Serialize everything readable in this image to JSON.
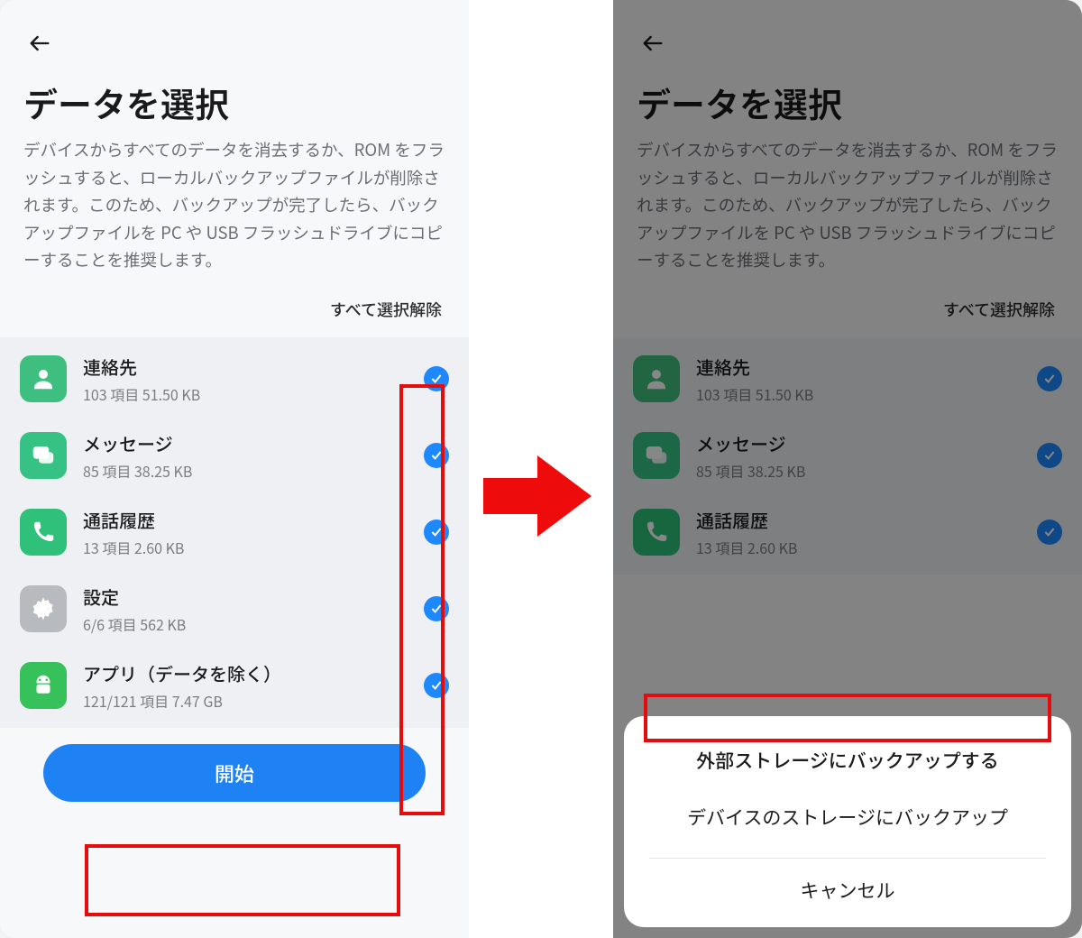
{
  "left": {
    "title": "データを選択",
    "description": "デバイスからすべてのデータを消去するか、ROM をフラッシュすると、ローカルバックアップファイルが削除されます。このため、バックアップが完了したら、バックアップファイルを PC や USB フラッシュドライブにコピーすることを推奨します。",
    "deselect_all": "すべて選択解除",
    "items": [
      {
        "icon": "contact",
        "title": "連絡先",
        "sub": "103 項目  51.50 KB"
      },
      {
        "icon": "message",
        "title": "メッセージ",
        "sub": "85 項目  38.25 KB"
      },
      {
        "icon": "call",
        "title": "通話履歴",
        "sub": "13 項目  2.60 KB"
      },
      {
        "icon": "settings",
        "title": "設定",
        "sub": "6/6 項目  562 KB"
      },
      {
        "icon": "apps",
        "title": "アプリ（データを除く）",
        "sub": "121/121 項目  7.47 GB"
      }
    ],
    "primary": "開始"
  },
  "right": {
    "title": "データを選択",
    "description": "デバイスからすべてのデータを消去するか、ROM をフラッシュすると、ローカルバックアップファイルが削除されます。このため、バックアップが完了したら、バックアップファイルを PC や USB フラッシュドライブにコピーすることを推奨します。",
    "deselect_all": "すべて選択解除",
    "items": [
      {
        "icon": "contact",
        "title": "連絡先",
        "sub": "103 項目  51.50 KB"
      },
      {
        "icon": "message",
        "title": "メッセージ",
        "sub": "85 項目  38.25 KB"
      },
      {
        "icon": "call",
        "title": "通話履歴",
        "sub": "13 項目  2.60 KB"
      }
    ],
    "sheet": {
      "opt1": "外部ストレージにバックアップする",
      "opt2": "デバイスのストレージにバックアップ",
      "cancel": "キャンセル"
    }
  }
}
